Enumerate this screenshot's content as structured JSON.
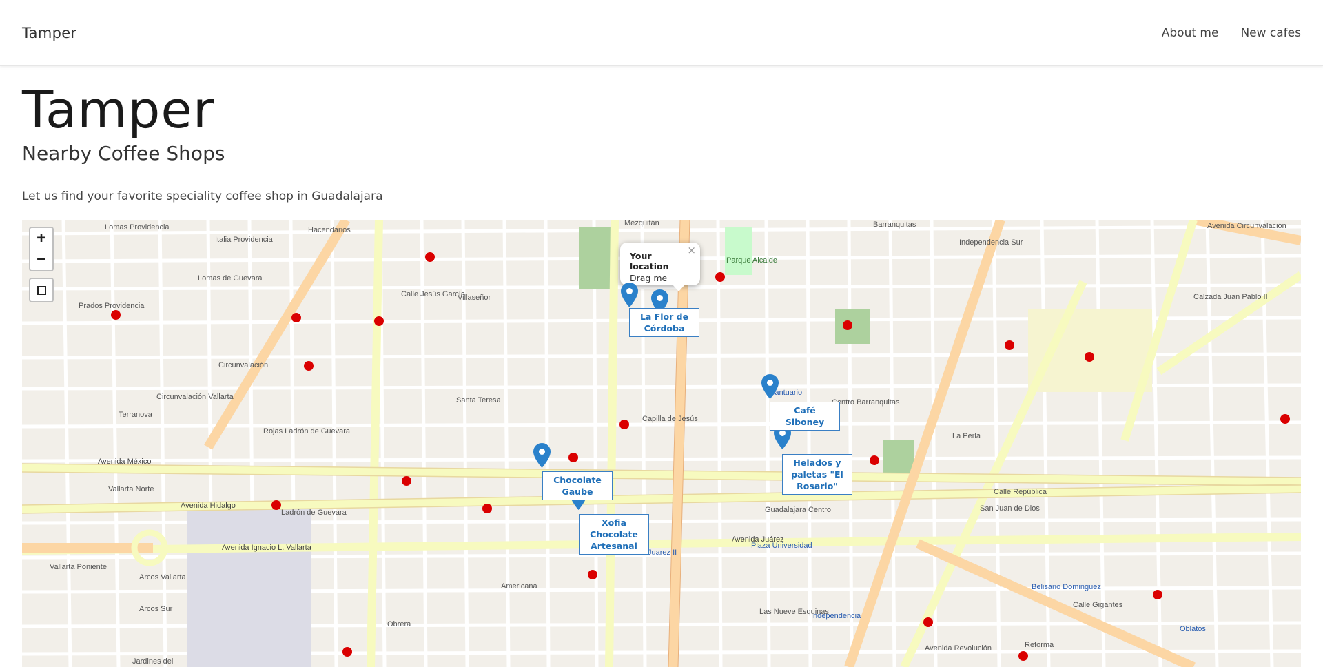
{
  "navbar": {
    "brand": "Tamper",
    "links": [
      "About me",
      "New cafes"
    ]
  },
  "hero": {
    "title": "Tamper",
    "subtitle": "Nearby Coffee Shops",
    "description": "Let us find your favorite speciality coffee shop in Guadalajara"
  },
  "map": {
    "zoom_in": "+",
    "zoom_out": "−",
    "popup": {
      "title": "Your location",
      "subtitle": "Drag me",
      "close": "×"
    },
    "shops": [
      {
        "name": "La Flor de\nCórdoba"
      },
      {
        "name": "Café Siboney"
      },
      {
        "name": "Helados y\npaletas \"El\nRosario\""
      },
      {
        "name": "Chocolate\nGaube"
      },
      {
        "name": "Xofia Chocolate\nArtesanal"
      }
    ],
    "marker_color": "#2a81cb",
    "street_labels": [
      "Lomas Providencia",
      "Hacendarios",
      "Italia Providencia",
      "Mezquitán",
      "Parque Alcalde",
      "Barranquitas",
      "Independencia Sur",
      "Avenida Circunvalación",
      "Villaseñor",
      "Calle Jesús García",
      "Prados Providencia",
      "Lomas de Guevara",
      "Circunvalación",
      "Circunvalación Vallarta",
      "Terranova",
      "Santa Teresa",
      "Capilla de Jesús",
      "Santuario",
      "Centro Barranquitas",
      "La Perla",
      "Avenida México",
      "Avenida Hidalgo",
      "Vallarta Norte",
      "Rojas Ladrón de Guevara",
      "Ladrón de Guevara",
      "Guadalajara Centro",
      "San Juan de Dios",
      "Plaza Universidad",
      "Juarez II",
      "Avenida Juárez",
      "Avenida Ignacio L. Vallarta",
      "Vallarta Poniente",
      "Arcos Vallarta",
      "Arcos Sur",
      "Americana",
      "Obrera",
      "Las Nueve Esquinas",
      "Independencia",
      "Belisario Dominguez",
      "Oblatos",
      "Reforma",
      "Jardines del",
      "Avenida Revolución",
      "Calle Gigantes",
      "Calzada Juan Pablo II",
      "Calle República"
    ]
  }
}
